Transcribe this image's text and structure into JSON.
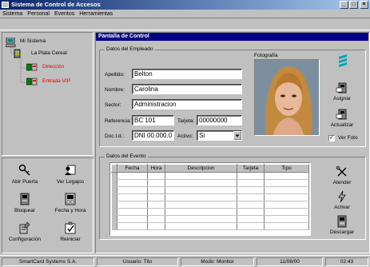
{
  "window": {
    "title": "Sistema de Control de Accesos",
    "controls": {
      "minimize": "_",
      "maximize": "□",
      "close": "×"
    }
  },
  "menu": {
    "items": [
      "Sistema",
      "Personal",
      "Eventos",
      "Herramientas"
    ]
  },
  "tree": {
    "root": "Mi Sistema",
    "node": "La Plata Cereal",
    "children": [
      "Dirección",
      "Entrada VIP"
    ]
  },
  "left_buttons": {
    "abrir": "Abir Puerta",
    "legajos": "Ver Legajos",
    "bloquear": "Bloquear",
    "fecha": "Fecha y Hora",
    "config": "Configuración",
    "reiniciar": "Reiniciar"
  },
  "main": {
    "header": "Pantalla de Control",
    "empleado_group": "Datos del Empleado",
    "foto_label": "Fotografía",
    "fields": {
      "apellido_label": "Apellido:",
      "apellido": "Belton",
      "nombre_label": "Nombre:",
      "nombre": "Carolina",
      "sector_label": "Sector:",
      "sector": "Administracion",
      "referencia_label": "Referencia:",
      "referencia": "BC 101",
      "tarjeta_label": "Tarjeta:",
      "tarjeta": "00000000",
      "docid_label": "Doc.I.d.:",
      "docid": "DNI 00.000.0",
      "activo_label": "Activo:",
      "activo": "Si"
    },
    "right_buttons": {
      "asignar": "Asignar",
      "actualizar": "Actualizar",
      "ver_foto": "Ver Foto"
    },
    "ver_foto_checked": true,
    "evento_group": "Datos del Evento",
    "event_table": {
      "columns": [
        "Fecha",
        "Hora",
        "Descripcion",
        "Tarjeta",
        "Tipo"
      ]
    },
    "event_buttons": {
      "atender": "Atender",
      "activar": "Activar",
      "descargar": "Descargar"
    }
  },
  "status": {
    "company": "SmartCard Systems S.A.",
    "usuario": "Usuario: Tito",
    "modo": "Modo: Monitor",
    "fecha": "11/08/00",
    "hora": "02:43"
  }
}
